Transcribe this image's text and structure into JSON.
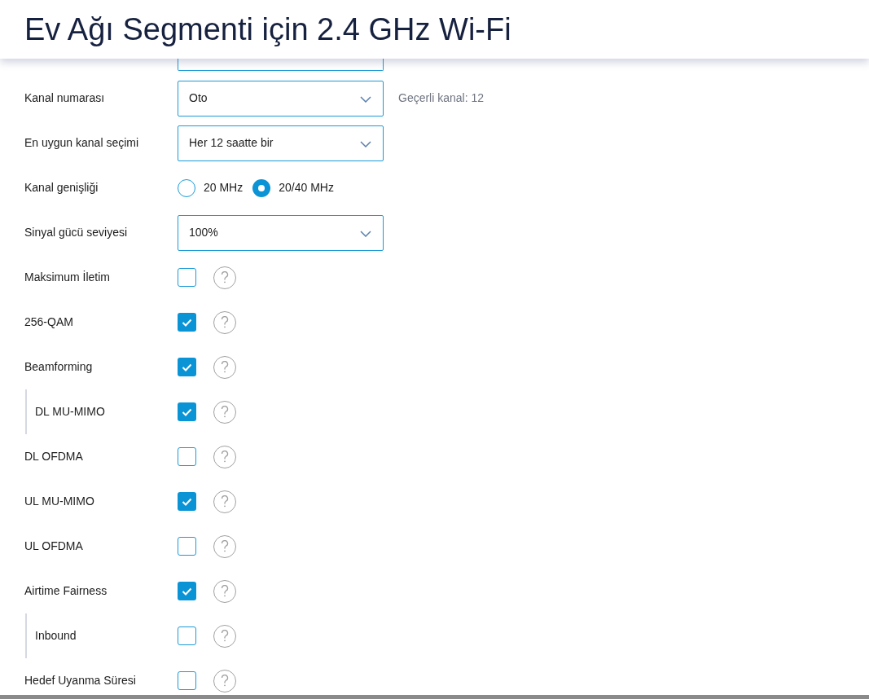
{
  "title": "Ev Ağı Segmenti için 2.4 GHz Wi-Fi",
  "settings": [
    {
      "kind": "select",
      "label": "Kanal numarası",
      "value": "Oto",
      "note": "Geçerli kanal: 12"
    },
    {
      "kind": "select",
      "label": "En uygun kanal seçimi",
      "value": "Her 12 saatte bir"
    },
    {
      "kind": "radio",
      "label": "Kanal genişliği",
      "options": [
        {
          "label": "20 MHz",
          "selected": false
        },
        {
          "label": "20/40 MHz",
          "selected": true
        }
      ]
    },
    {
      "kind": "select",
      "label": "Sinyal gücü seviyesi",
      "value": "100%"
    },
    {
      "kind": "checkbox",
      "label": "Maksimum İletim",
      "checked": false
    },
    {
      "kind": "checkbox",
      "label": "256-QAM",
      "checked": true
    },
    {
      "kind": "checkbox",
      "label": "Beamforming",
      "checked": true,
      "children": [
        {
          "kind": "checkbox",
          "label": "DL MU-MIMO",
          "checked": true
        }
      ]
    },
    {
      "kind": "checkbox",
      "label": "DL OFDMA",
      "checked": false
    },
    {
      "kind": "checkbox",
      "label": "UL MU-MIMO",
      "checked": true
    },
    {
      "kind": "checkbox",
      "label": "UL OFDMA",
      "checked": false
    },
    {
      "kind": "checkbox",
      "label": "Airtime Fairness",
      "checked": true,
      "children": [
        {
          "kind": "checkbox",
          "label": "Inbound",
          "checked": false
        }
      ]
    },
    {
      "kind": "checkbox",
      "label": "Hedef Uyanma Süresi",
      "checked": false
    }
  ]
}
